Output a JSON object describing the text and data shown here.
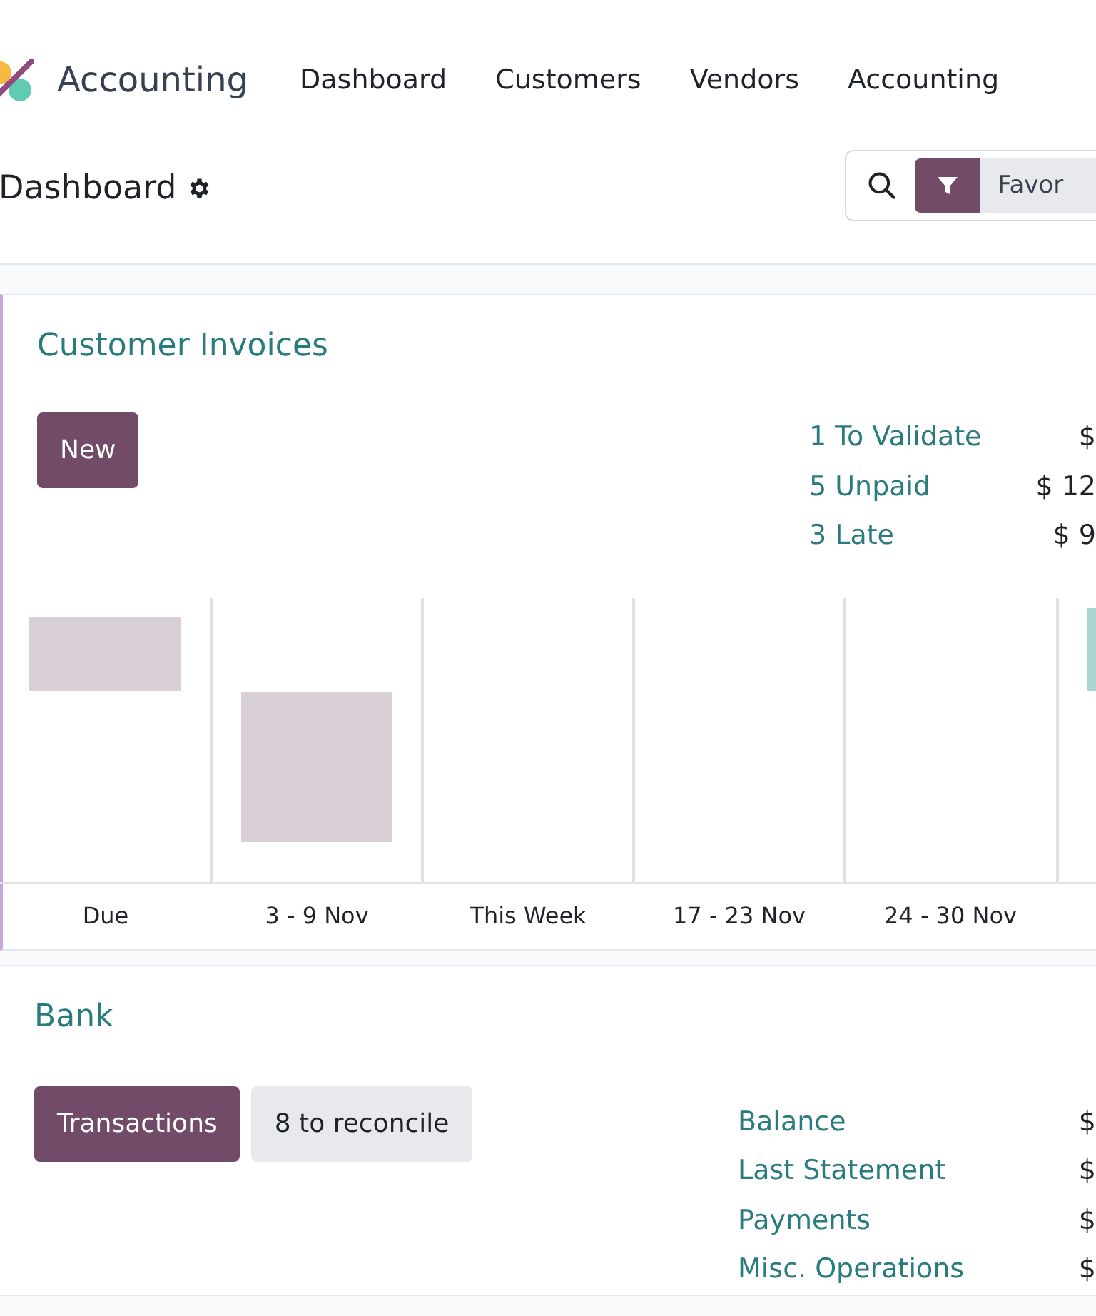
{
  "app": {
    "name": "Accounting"
  },
  "menu": [
    {
      "label": "Dashboard"
    },
    {
      "label": "Customers"
    },
    {
      "label": "Vendors"
    },
    {
      "label": "Accounting"
    }
  ],
  "control_panel": {
    "title": "Dashboard",
    "filter_label": "Favor"
  },
  "cards": [
    {
      "kind": "invoices",
      "title": "Customer Invoices",
      "buttons": [
        {
          "label": "New",
          "primary": true
        }
      ],
      "stats": [
        {
          "label": "1 To Validate",
          "amount": "$"
        },
        {
          "label": "5 Unpaid",
          "amount": "$ 12"
        },
        {
          "label": "3 Late",
          "amount": "$ 9"
        }
      ],
      "chart_labels": [
        "Due",
        "3 - 9 Nov",
        "This Week",
        "17 - 23 Nov",
        "24 - 30 Nov"
      ]
    },
    {
      "kind": "bank",
      "title": "Bank",
      "buttons": [
        {
          "label": "Transactions",
          "primary": true
        },
        {
          "label": "8 to reconcile",
          "primary": false
        }
      ],
      "stats": [
        {
          "label": "Balance",
          "amount": "$"
        },
        {
          "label": "Last Statement",
          "amount": "$"
        },
        {
          "label": "Payments",
          "amount": "$"
        },
        {
          "label": "Misc. Operations",
          "amount": "$"
        }
      ]
    }
  ]
}
